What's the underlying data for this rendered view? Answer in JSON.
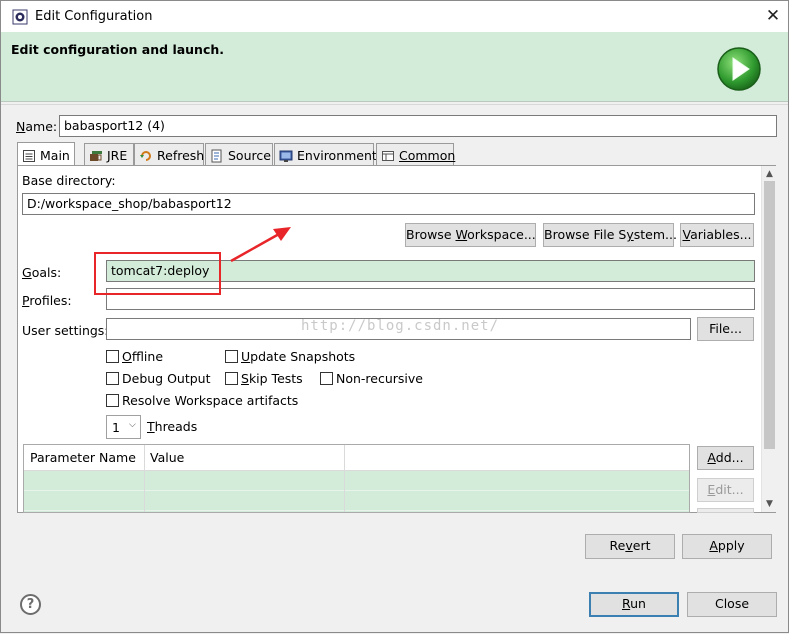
{
  "window": {
    "title": "Edit Configuration",
    "close_glyph": "✕"
  },
  "banner": {
    "title": "Edit configuration and launch.",
    "icon": "run-icon"
  },
  "name": {
    "label": "Name:",
    "value": "babasport12 (4)"
  },
  "tabs": [
    {
      "label": "Main",
      "icon": "main-tab-icon",
      "active": true
    },
    {
      "label": "JRE",
      "icon": "jre-icon"
    },
    {
      "label": "Refresh",
      "icon": "refresh-icon"
    },
    {
      "label": "Source",
      "icon": "source-icon"
    },
    {
      "label": "Environment",
      "icon": "environment-icon"
    },
    {
      "label": "Common",
      "icon": "common-icon"
    }
  ],
  "main": {
    "base_directory_label": "Base directory:",
    "base_directory_value": "D:/workspace_shop/babasport12",
    "browse_workspace": "Browse Workspace...",
    "browse_file_system": "Browse File System...",
    "variables": "Variables...",
    "goals_label": "Goals:",
    "goals_value": "tomcat7:deploy",
    "profiles_label": "Profiles:",
    "profiles_value": "",
    "user_settings_label": "User settings:",
    "user_settings_value": "",
    "file_button": "File...",
    "offline": "Offline",
    "update_snapshots": "Update Snapshots",
    "debug_output": "Debug Output",
    "skip_tests": "Skip Tests",
    "non_recursive": "Non-recursive",
    "resolve_workspace": "Resolve Workspace artifacts",
    "threads_value": "1",
    "threads_label": "Threads",
    "table_headers": [
      "Parameter Name",
      "Value"
    ],
    "add_button": "Add...",
    "edit_button": "Edit..."
  },
  "watermark": "http://blog.csdn.net/",
  "footer": {
    "revert": "Revert",
    "apply": "Apply",
    "run": "Run",
    "close": "Close",
    "help_glyph": "?"
  },
  "colors": {
    "banner_bg": "#d3ecd9",
    "highlight_bg": "#d3ecd9",
    "annotation_red": "#e8262a",
    "default_button_border": "#3c7fb1"
  }
}
